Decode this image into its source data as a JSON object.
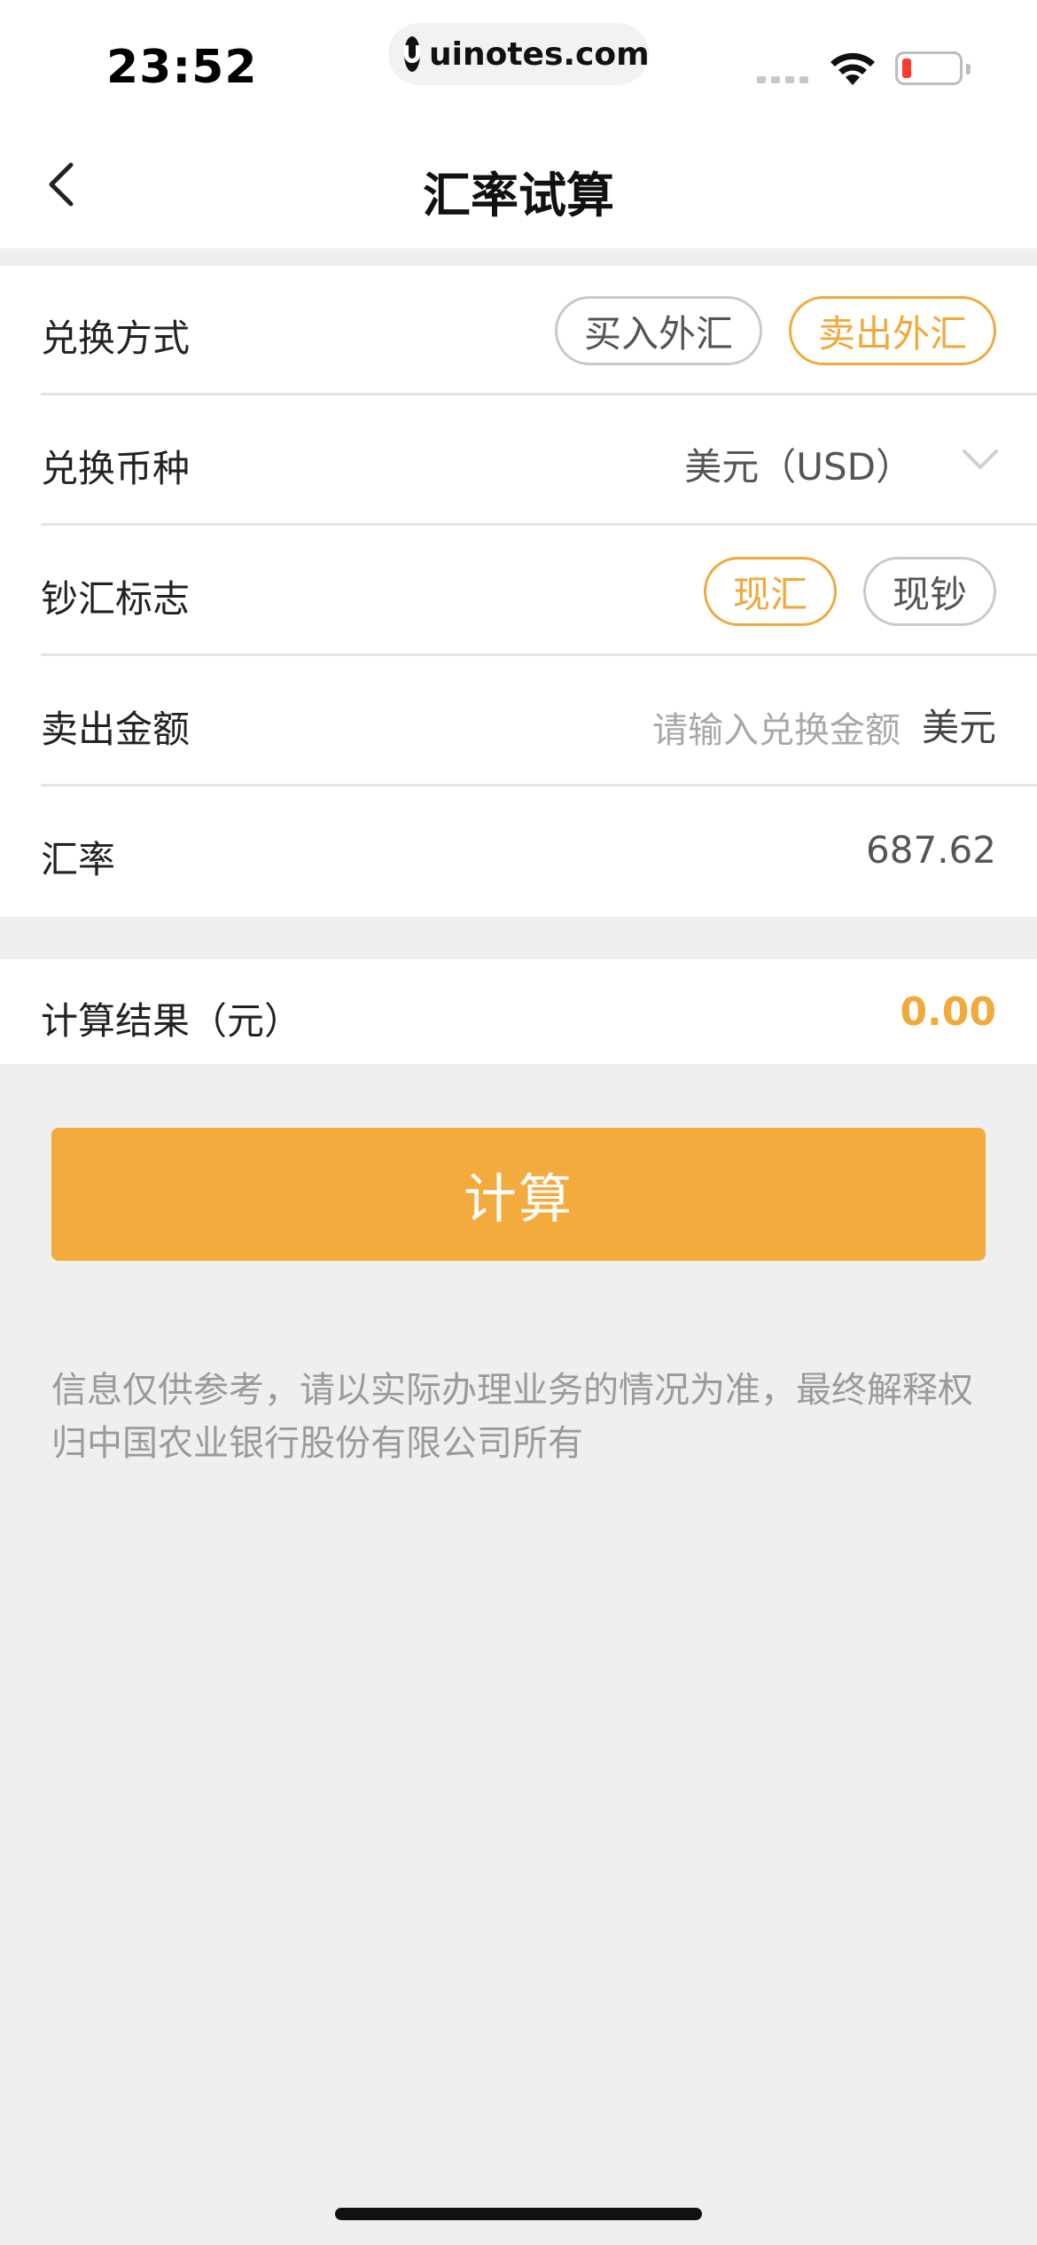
{
  "status_bar": {
    "time": "23:52",
    "url": "uinotes.com",
    "icons": [
      "signal-icon",
      "wifi-icon",
      "battery-icon"
    ],
    "battery_color": "#ff3b30"
  },
  "nav": {
    "title": "汇率试算",
    "back_icon": "back-chevron-icon"
  },
  "form": {
    "exchange_method": {
      "label": "兑换方式",
      "options": [
        "买入外汇",
        "卖出外汇"
      ],
      "selected": "卖出外汇"
    },
    "currency": {
      "label": "兑换币种",
      "value": "美元（USD）"
    },
    "cash_flag": {
      "label": "钞汇标志",
      "options": [
        "现汇",
        "现钞"
      ],
      "selected": "现汇"
    },
    "amount": {
      "label": "卖出金额",
      "placeholder": "请输入兑换金额",
      "unit": "美元"
    },
    "rate": {
      "label": "汇率",
      "value": "687.62"
    }
  },
  "result": {
    "label": "计算结果（元）",
    "value": "0.00"
  },
  "calc_button": {
    "label": "计算"
  },
  "disclaimer": "信息仅供参考，请以实际办理业务的情况为准，最终解释权归中国农业银行股份有限公司所有",
  "colors": {
    "accent": "#f0a93b",
    "button_bg": "#f3ab3e",
    "background": "#efefef"
  }
}
